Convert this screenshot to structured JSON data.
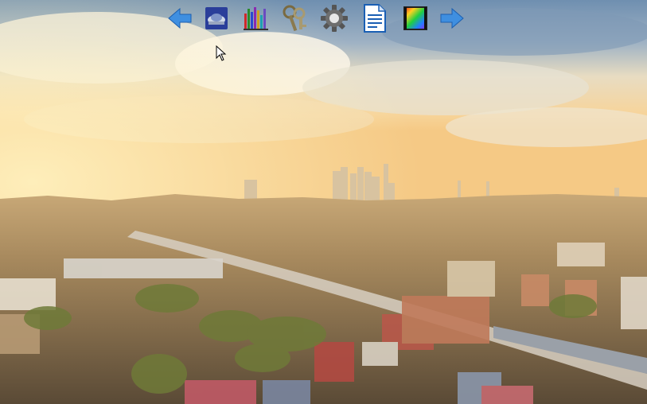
{
  "desktop": {
    "wallpaper": "city-skyline-sunset-photo",
    "toolbar": {
      "buttons": [
        {
          "id": "back",
          "icon": "left-arrow-icon",
          "color": "#3f8fe0"
        },
        {
          "id": "display",
          "icon": "scanner-icon",
          "color": "#2f4db0"
        },
        {
          "id": "stats",
          "icon": "bar-chart-icon",
          "color": "#6a4bc0"
        },
        {
          "id": "keys",
          "icon": "keys-icon",
          "color": "#8a7a50"
        },
        {
          "id": "settings",
          "icon": "gear-icon",
          "color": "#555555"
        },
        {
          "id": "document",
          "icon": "document-icon",
          "color": "#1a5fb4"
        },
        {
          "id": "color",
          "icon": "color-gradient-icon",
          "color": "#e0402a"
        },
        {
          "id": "forward",
          "icon": "right-arrow-icon",
          "color": "#3f8fe0"
        }
      ]
    }
  }
}
